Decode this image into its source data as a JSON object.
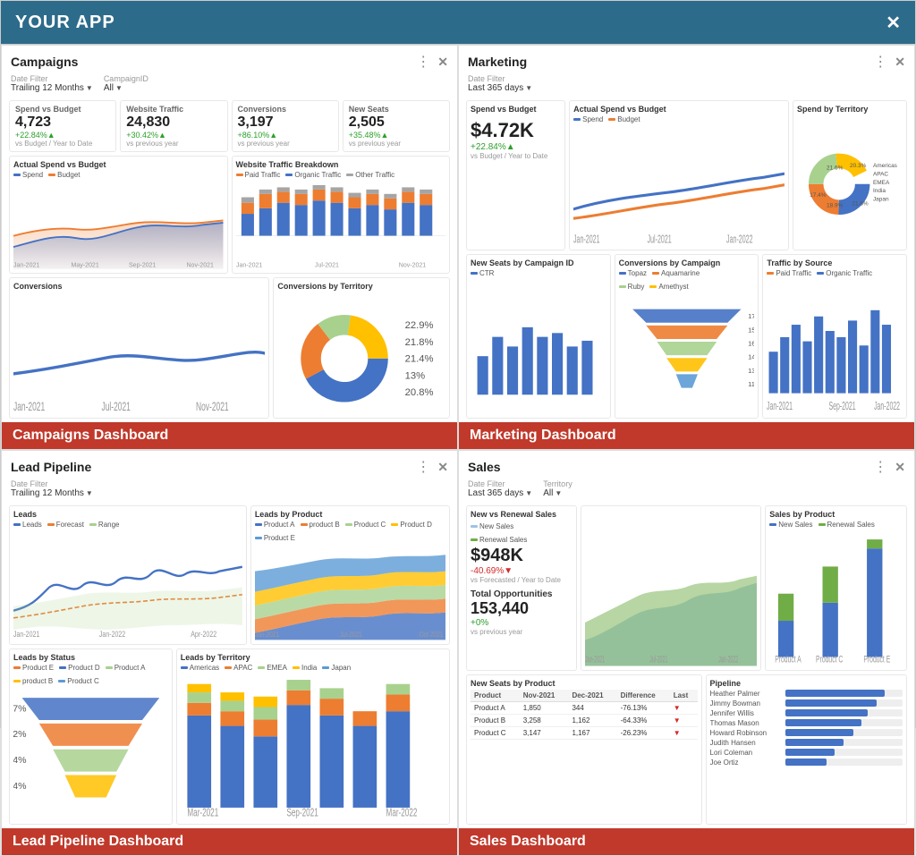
{
  "app": {
    "title": "YOUR APP",
    "close_label": "✕"
  },
  "panels": {
    "campaigns": {
      "title": "Campaigns",
      "filter_label": "Date Filter",
      "filter_value": "Trailing 12 Months",
      "filter2_label": "CampaignID",
      "filter2_value": "All",
      "banner": "Campaigns Dashboard",
      "kpis": [
        {
          "title": "Spend vs Budget",
          "value": "4,723",
          "change": "+22.84%▲",
          "change_type": "positive",
          "sub": "vs Budget / Year to Date"
        },
        {
          "title": "Website Traffic",
          "value": "24,830",
          "change": "+30.42%▲",
          "change_type": "positive",
          "sub": "vs previous year"
        },
        {
          "title": "Conversions",
          "value": "3,197",
          "change": "+86.10%▲",
          "change_type": "positive",
          "sub": "vs previous year"
        },
        {
          "title": "New Seats",
          "value": "2,505",
          "change": "+35.48%▲",
          "change_type": "positive",
          "sub": "vs previous year"
        }
      ],
      "charts": {
        "actual_spend": "Actual Spend vs Budget",
        "website_traffic": "Website Traffic Breakdown",
        "conversions": "Conversions",
        "conversions_territory": "Conversions by Territory"
      }
    },
    "marketing": {
      "title": "Marketing",
      "filter_label": "Date Filter",
      "filter_value": "Last 365 days",
      "banner": "Marketing Dashboard",
      "spend_value": "$4.72K",
      "spend_change": "+22.84%▲",
      "spend_sub": "vs Budget / Year to Date",
      "charts": {
        "spend_budget": "Spend vs Budget",
        "actual_spend": "Actual Spend vs Budget",
        "spend_territory": "Spend by Territory",
        "new_seats": "New Seats by Campaign ID",
        "conversions_campaign": "Conversions by Campaign",
        "traffic_source": "Traffic by Source"
      }
    },
    "lead_pipeline": {
      "title": "Lead Pipeline",
      "filter_label": "Date Filter",
      "filter_value": "Trailing 12 Months",
      "banner": "Lead Pipeline Dashboard",
      "charts": {
        "leads": "Leads",
        "leads_product": "Leads by Product",
        "leads_status": "Leads by Status",
        "leads_territory": "Leads by Territory"
      }
    },
    "sales": {
      "title": "Sales",
      "filter_label": "Date Filter",
      "filter_value": "Last 365 days",
      "filter2_label": "Territory",
      "filter2_value": "All",
      "banner": "Sales Dashboard",
      "sales_value": "$948K",
      "sales_change": "-40.69%▼",
      "sales_sub": "vs Forecasted / Year to Date",
      "total_opps_label": "Total Opportunities",
      "total_opps_value": "153,440",
      "total_opps_change": "+0%",
      "total_opps_sub": "vs previous year",
      "charts": {
        "new_vs_renewal": "New vs Renewal Sales",
        "sales_product": "Sales by Product",
        "new_seats_product": "New Seats by Product",
        "sales_table": "Sales",
        "pipeline": "Pipeline"
      },
      "table_headers": [
        "Product",
        "Nov-2021",
        "Dec-2021",
        "Difference",
        "Last"
      ],
      "table_rows": [
        {
          "product": "Product A",
          "nov": "1,850",
          "dec": "344",
          "diff": "-76.13%",
          "diff_type": "negative"
        },
        {
          "product": "Product B",
          "nov": "3,258",
          "dec": "1,162",
          "diff": "-64.33%",
          "diff_type": "negative"
        },
        {
          "product": "Product C",
          "nov": "3,147",
          "dec": "1,167",
          "diff": "-26.23%",
          "diff_type": "negative"
        }
      ],
      "pipeline_people": [
        {
          "name": "Heather Palmer",
          "val": 85
        },
        {
          "name": "Jimmy Bowman",
          "val": 78
        },
        {
          "name": "Jennifer Willis",
          "val": 70
        },
        {
          "name": "Thomas Mason",
          "val": 65
        },
        {
          "name": "Howard Robinson",
          "val": 58
        },
        {
          "name": "Judith Hansen",
          "val": 50
        },
        {
          "name": "Lori Coleman",
          "val": 42
        },
        {
          "name": "Joe Ortiz",
          "val": 35
        }
      ]
    }
  },
  "colors": {
    "spend": "#4472c4",
    "budget": "#ed7d31",
    "paid_traffic": "#ed7d31",
    "organic_traffic": "#4472c4",
    "other_traffic": "#a5a5a5",
    "new_sales": "#9dc3e6",
    "renewal_sales": "#70ad47",
    "product_a": "#4472c4",
    "product_b": "#ed7d31",
    "product_c": "#a9d18e",
    "product_d": "#ffc000",
    "product_e": "#5b9bd5",
    "americas": "#4472c4",
    "apac": "#ed7d31",
    "emea": "#a9d18e",
    "india": "#ffc000",
    "japan": "#5b9bd5",
    "banner_bg": "#c0392b",
    "header_bg": "#2d6b8a"
  }
}
